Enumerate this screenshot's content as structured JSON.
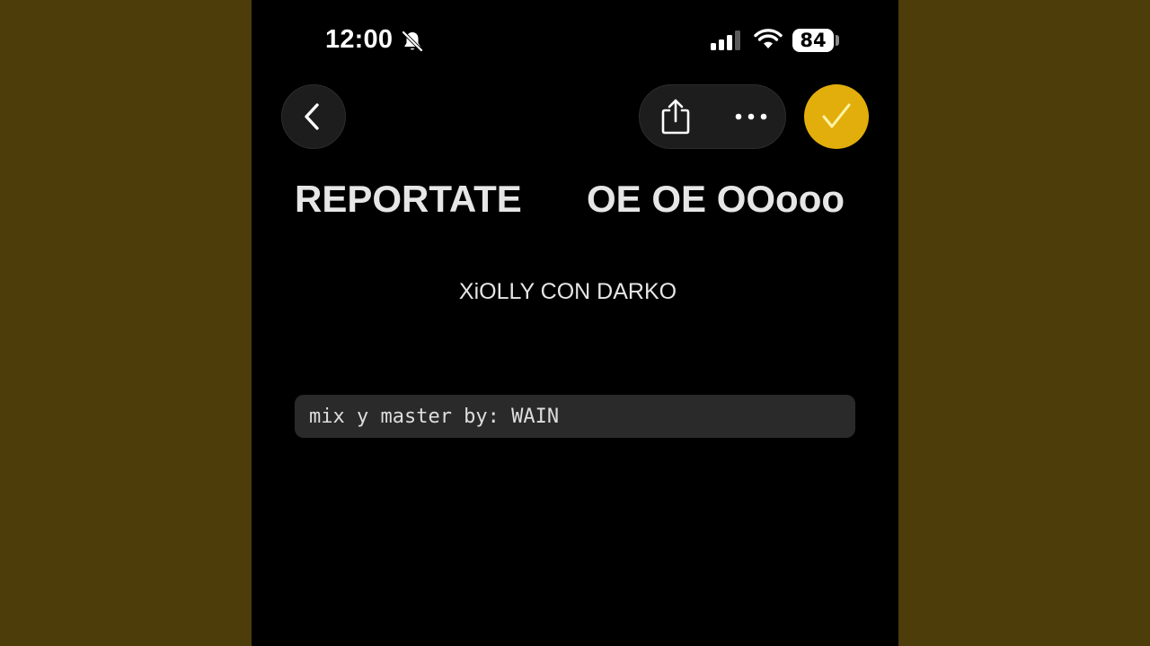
{
  "status_bar": {
    "time": "12:00",
    "battery": "84",
    "icons": [
      "bell-slash-icon",
      "cellular-signal-icon",
      "wifi-icon",
      "battery-icon"
    ]
  },
  "nav": {
    "back_icon": "chevron-left-icon",
    "share_icon": "share-icon",
    "more_icon": "ellipsis-icon",
    "done_icon": "checkmark-icon"
  },
  "content": {
    "title_left": "REPORTATE",
    "title_right": "OE OE OOooo",
    "subtitle": "XiOLLY CON DARKO",
    "code_line": "mix y master by: WAIN"
  },
  "colors": {
    "side_background": "#4d3d0b",
    "screen_background": "#000000",
    "accent": "#e2ae0c",
    "checkmark": "#fff3a8"
  }
}
